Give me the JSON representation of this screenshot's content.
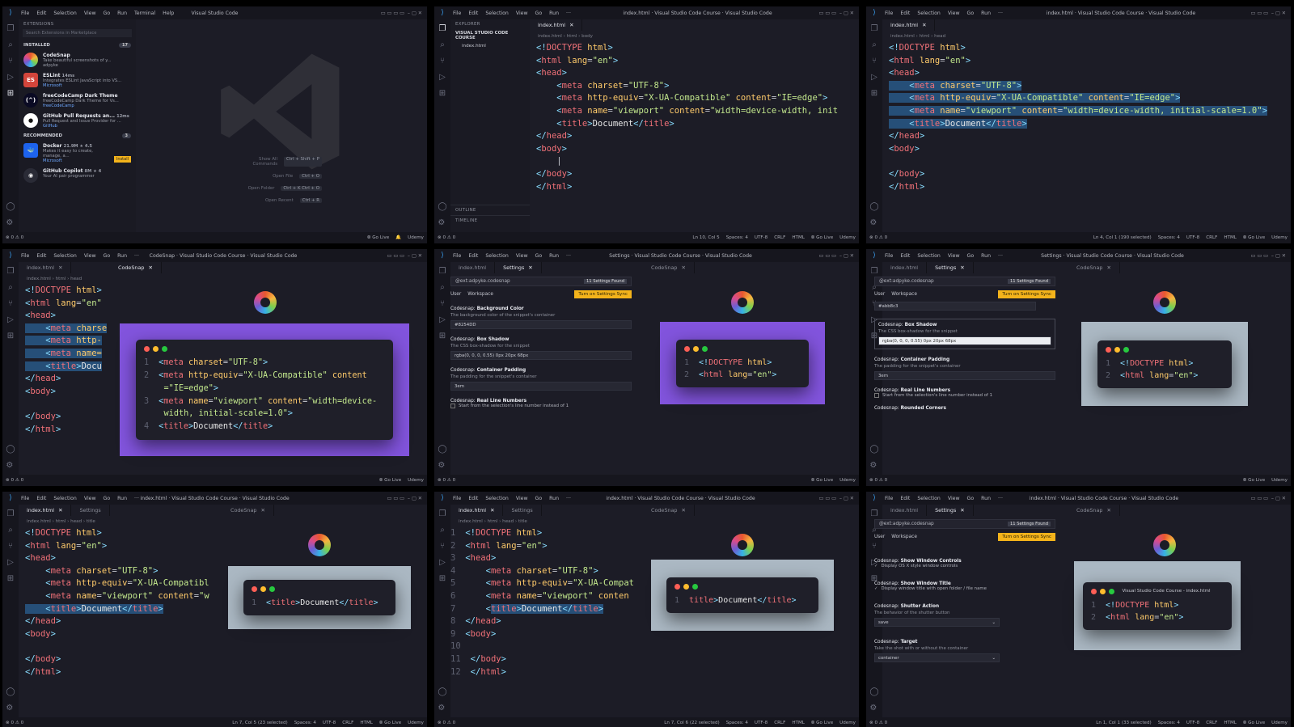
{
  "common": {
    "menu": [
      "File",
      "Edit",
      "Selection",
      "View",
      "Go",
      "Run",
      "Terminal",
      "Help"
    ],
    "menu_short": [
      "File",
      "Edit",
      "Selection",
      "View",
      "Go",
      "Run",
      "···"
    ],
    "status_left": "⊗ 0 ⚠ 0",
    "golive": "⦾ Go Live",
    "brand": "Udemy",
    "tab_index": "index.html",
    "tab_settings": "Settings",
    "tab_codesnap": "CodeSnap"
  },
  "p00": {
    "title": "Visual Studio Code",
    "sidebar_title": "EXTENSIONS",
    "search_placeholder": "Search Extensions in Marketplace",
    "installed_label": "INSTALLED",
    "installed_count": "17",
    "recommended_label": "RECOMMENDED",
    "recommended_count": "3",
    "extensions": [
      {
        "name": "CodeSnap",
        "desc": "Take beautiful screenshots of y...",
        "pub": "adpyke",
        "meta": ""
      },
      {
        "name": "ESLint",
        "desc": "Integrates ESLint JavaScript into VS...",
        "pub": "Microsoft",
        "meta": "14ms"
      },
      {
        "name": "freeCodeCamp Dark Theme",
        "desc": "freeCodeCamp Dark Theme for Vs...",
        "pub": "freeCodeCamp",
        "meta": ""
      },
      {
        "name": "GitHub Pull Requests an...",
        "desc": "Pull Request and Issue Provider for ...",
        "pub": "GitHub",
        "meta": "12ms"
      }
    ],
    "recommended": [
      {
        "name": "Docker",
        "desc": "Makes it easy to create, manage, a...",
        "pub": "Microsoft",
        "meta": "21.9M ★ 4.5",
        "action": "Install"
      },
      {
        "name": "GitHub Copilot",
        "desc": "Your AI pair programmer",
        "pub": "",
        "meta": "8M ★ 4"
      }
    ],
    "welcome": [
      {
        "label": "Show All Commands",
        "keys": "Ctrl + Shift + P"
      },
      {
        "label": "Open File",
        "keys": "Ctrl + O"
      },
      {
        "label": "Open Folder",
        "keys": "Ctrl + K   Ctrl + O"
      },
      {
        "label": "Open Recent",
        "keys": "Ctrl + R"
      }
    ]
  },
  "p01": {
    "title": "index.html · Visual Studio Code Course · Visual Studio Code",
    "explorer": "EXPLORER",
    "folder": "VISUAL STUDIO CODE COURSE",
    "file": "index.html",
    "outline": "OUTLINE",
    "timeline": "TIMELINE",
    "crumb": "index.html › html › body",
    "status": [
      "Ln 10, Col 5",
      "Spaces: 4",
      "UTF-8",
      "CRLF",
      "HTML"
    ]
  },
  "p02": {
    "title": "index.html · Visual Studio Code Course · Visual Studio Code",
    "crumb": "index.html › html › head",
    "status": [
      "Ln 4, Col 1 (190 selected)",
      "Spaces: 4",
      "UTF-8",
      "CRLF",
      "HTML"
    ]
  },
  "p10": {
    "title": "CodeSnap · Visual Studio Code Course · Visual Studio Code",
    "crumb": "index.html › html › head"
  },
  "p11": {
    "title": "Settings · Visual Studio Code Course · Visual Studio Code",
    "search": "@ext:adpyke.codesnap",
    "found": "11 Settings Found",
    "user": "User",
    "workspace": "Workspace",
    "sync": "Turn on Settings Sync",
    "items": [
      {
        "prefix": "Codesnap: ",
        "name": "Background Color",
        "desc": "The background color of the snippet's container",
        "value": "#8254DD"
      },
      {
        "prefix": "Codesnap: ",
        "name": "Box Shadow",
        "desc": "The CSS box-shadow for the snippet",
        "value": "rgba(0, 0, 0, 0.55) 0px 20px 68px"
      },
      {
        "prefix": "Codesnap: ",
        "name": "Container Padding",
        "desc": "The padding for the snippet's container",
        "value": "3em"
      },
      {
        "prefix": "Codesnap: ",
        "name": "Real Line Numbers",
        "desc": "Start from the selection's line number instead of 1",
        "value": ""
      }
    ]
  },
  "p12": {
    "title": "Settings · Visual Studio Code Course · Visual Studio Code",
    "prev_value": "#abb8c3",
    "items": [
      {
        "prefix": "Codesnap: ",
        "name": "Box Shadow",
        "desc": "The CSS box-shadow for the snippet",
        "value": "rgba(0, 0, 0, 0.55) 0px 20px 68px"
      },
      {
        "prefix": "Codesnap: ",
        "name": "Container Padding",
        "desc": "The padding for the snippet's container",
        "value": "3em"
      },
      {
        "prefix": "Codesnap: ",
        "name": "Real Line Numbers",
        "desc": "Start from the selection's line number instead of 1",
        "value": ""
      },
      {
        "prefix": "Codesnap: ",
        "name": "Rounded Corners",
        "desc": "",
        "value": ""
      }
    ]
  },
  "p20": {
    "title": "index.html · Visual Studio Code Course · Visual Studio Code",
    "crumb": "index.html › html › head › title",
    "status": [
      "Ln 7, Col 5 (23 selected)",
      "Spaces: 4",
      "UTF-8",
      "CRLF",
      "HTML"
    ]
  },
  "p21": {
    "title": "index.html · Visual Studio Code Course · Visual Studio Code",
    "crumb": "index.html › html › head › title",
    "status": [
      "Ln 7, Col 6 (22 selected)",
      "Spaces: 4",
      "UTF-8",
      "CRLF",
      "HTML"
    ]
  },
  "p22": {
    "title": "index.html · Visual Studio Code Course · Visual Studio Code",
    "items": [
      {
        "prefix": "Codesnap: ",
        "name": "Show Window Controls",
        "desc": "Display OS X style window controls",
        "value": ""
      },
      {
        "prefix": "Codesnap: ",
        "name": "Show Window Title",
        "desc": "Display window title with open folder / file name",
        "value": ""
      },
      {
        "prefix": "Codesnap: ",
        "name": "Shutter Action",
        "desc": "The behavior of the shutter button",
        "value": "save"
      },
      {
        "prefix": "Codesnap: ",
        "name": "Target",
        "desc": "Take the shot with or without the container",
        "value": "container"
      }
    ],
    "snap_title": "Visual Studio Code Course - index.html",
    "status": [
      "Ln 1, Col 1 (33 selected)",
      "Spaces: 4",
      "UTF-8",
      "CRLF",
      "HTML"
    ]
  },
  "colors": {
    "accent": "#3aa0f2",
    "purple": "#8254DD",
    "grey_bg": "#abb8c3",
    "sync": "#f3b31b"
  }
}
